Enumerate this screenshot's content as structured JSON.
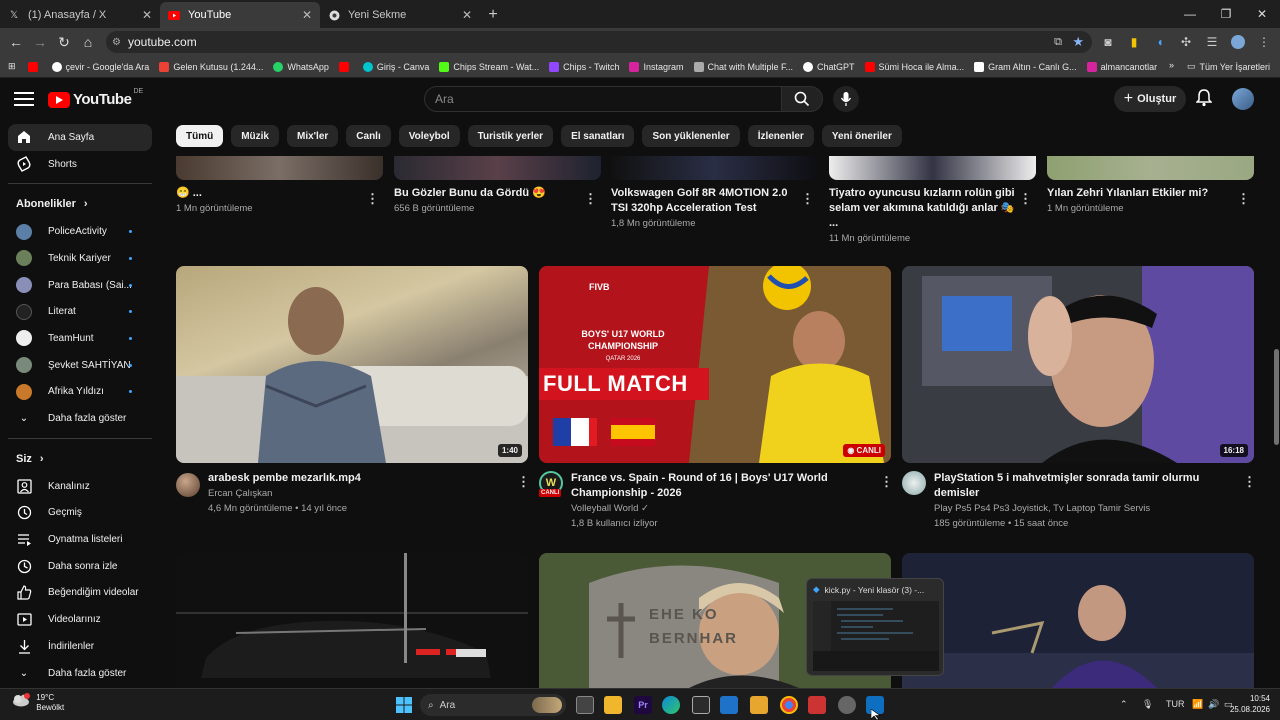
{
  "browser": {
    "tabs": [
      {
        "label": "(1) Anasayfa / X",
        "icon": "x-logo-icon"
      },
      {
        "label": "YouTube",
        "icon": "youtube-icon"
      },
      {
        "label": "Yeni Sekme",
        "icon": "chrome-icon"
      }
    ],
    "url": "youtube.com",
    "bookmarks": [
      "",
      "çevir - Google'da Ara",
      "Gelen Kutusu (1.244...",
      "WhatsApp",
      "",
      "Giriş - Canva",
      "Chips Stream - Wat...",
      "Chips - Twitch",
      "Instagram",
      "Chat with Multiple F...",
      "ChatGPT",
      "Sümi Hoca ile Alma...",
      "Gram Altın - Canlı G...",
      "almancanotlar"
    ],
    "all_bookmarks": "Tüm Yer İşaretleri"
  },
  "youtube": {
    "logo": "YouTube",
    "region": "DE",
    "search_placeholder": "Ara",
    "create_label": "Oluştur",
    "chips": [
      "Tümü",
      "Müzik",
      "Mix'ler",
      "Canlı",
      "Voleybol",
      "Turistik yerler",
      "El sanatları",
      "Son yüklenenler",
      "İzlenenler",
      "Yeni öneriler"
    ]
  },
  "sidebar": {
    "home": "Ana Sayfa",
    "shorts": "Shorts",
    "subs_title": "Abonelikler",
    "subs": [
      "PoliceActivity",
      "Teknik Kariyer",
      "Para Babası (Sai...",
      "Literat",
      "TeamHunt",
      "Şevket SAHTİYAN",
      "Afrika Yıldızı"
    ],
    "show_more": "Daha fazla göster",
    "you_title": "Siz",
    "you": [
      "Kanalınız",
      "Geçmiş",
      "Oynatma listeleri",
      "Daha sonra izle",
      "Beğendiğim videolar",
      "Videolarınız",
      "İndirilenler"
    ],
    "show_more2": "Daha fazla göster"
  },
  "top_row": [
    {
      "title": "😁 ...",
      "meta": "1 Mn görüntüleme"
    },
    {
      "title": "Bu Gözler Bunu da Gördü 😍",
      "meta": "656 B görüntüleme"
    },
    {
      "title": "Volkswagen Golf 8R 4MOTION 2.0 TSI 320hp Acceleration Test",
      "meta": "1,8 Mn görüntüleme"
    },
    {
      "title": "Tiyatro oyuncusu kızların rolün gibi selam ver akımına katıldığı anlar 🎭 ...",
      "meta": "11 Mn görüntüleme"
    },
    {
      "title": "Yılan Zehri Yılanları Etkiler mi?",
      "meta": "1 Mn görüntüleme"
    }
  ],
  "mid_row": [
    {
      "title": "arabesk pembe mezarlık.mp4",
      "channel": "Ercan Çalışkan",
      "meta": "4,6 Mn görüntüleme • 14 yıl önce",
      "duration": "1:40"
    },
    {
      "title": "France vs. Spain - Round of 16 | Boys' U17 World Championship - 2026",
      "channel": "Volleyball World ✓",
      "meta": "1,8 B kullanıcı izliyor",
      "badge": "CANLI",
      "overlay_top": "BOYS' U17 WORLD CHAMPIONSHIP",
      "overlay_sub": "QATAR 2026",
      "overlay_main": "FULL MATCH",
      "brand": "FIVB"
    },
    {
      "title": "PlayStation 5 i mahvetmişler sonrada tamir olurmu demisler",
      "channel": "Play Ps5 Ps4 Ps3 Joyistick, Tv Laptop Tamir Servis",
      "meta": "185 görüntüleme • 15 saat önce",
      "duration": "16:18"
    }
  ],
  "bottom_row": {
    "plate": "",
    "gravestone": "EHE KO BERNHAR"
  },
  "popup": {
    "title": "kick.py - Yeni klasör (3) -..."
  },
  "taskbar": {
    "temp": "19°C",
    "weather": "Bewölkt",
    "search": "Ara",
    "lang": "TUR",
    "time": "10:54",
    "date": "25.08.2026"
  }
}
